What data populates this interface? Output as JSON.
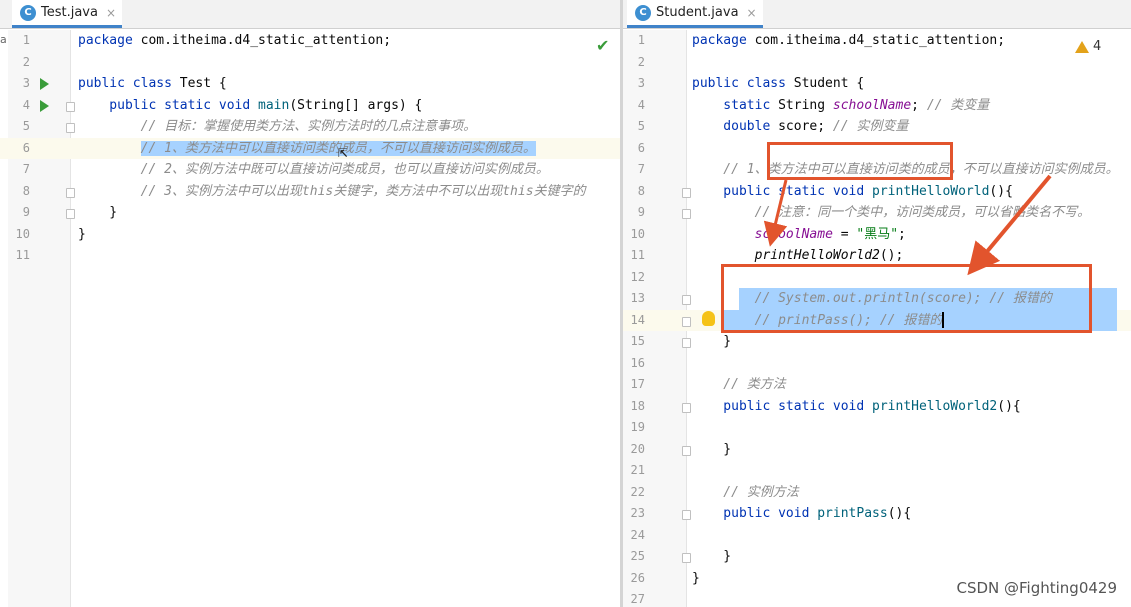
{
  "edge_char": "a",
  "left": {
    "tab": {
      "icon": "C",
      "label": "Test.java",
      "close": "×"
    },
    "lines": [
      {
        "n": "1",
        "parts": [
          {
            "t": "package ",
            "c": "kw"
          },
          {
            "t": "com.itheima.d4_static_attention;",
            "c": ""
          }
        ]
      },
      {
        "n": "2",
        "parts": []
      },
      {
        "n": "3",
        "parts": [
          {
            "t": "public class ",
            "c": "kw"
          },
          {
            "t": "Test {",
            "c": ""
          }
        ]
      },
      {
        "n": "4",
        "parts": [
          {
            "t": "    public static void ",
            "c": "kw"
          },
          {
            "t": "main",
            "c": "fn"
          },
          {
            "t": "(String[] args) {",
            "c": ""
          }
        ]
      },
      {
        "n": "5",
        "parts": [
          {
            "t": "        // 目标：掌握使用类方法、实例方法时的几点注意事项。",
            "c": "cm"
          }
        ]
      },
      {
        "n": "6",
        "parts": [
          {
            "t": "        ",
            "c": ""
          },
          {
            "t": "// 1、类方法中可以直接访问类的成员，不可以直接访问实例成员。",
            "c": "cm sel"
          }
        ]
      },
      {
        "n": "7",
        "parts": [
          {
            "t": "        // 2、实例方法中既可以直接访问类成员，也可以直接访问实例成员。",
            "c": "cm"
          }
        ]
      },
      {
        "n": "8",
        "parts": [
          {
            "t": "        // 3、实例方法中可以出现this关键字，类方法中不可以出现this关键字的",
            "c": "cm"
          }
        ]
      },
      {
        "n": "9",
        "parts": [
          {
            "t": "    }",
            "c": ""
          }
        ]
      },
      {
        "n": "10",
        "parts": [
          {
            "t": "}",
            "c": ""
          }
        ]
      },
      {
        "n": "11",
        "parts": []
      }
    ]
  },
  "right": {
    "tab": {
      "icon": "C",
      "label": "Student.java",
      "close": "×"
    },
    "warnings": "4",
    "lines": [
      {
        "n": "1",
        "parts": [
          {
            "t": "package ",
            "c": "kw"
          },
          {
            "t": "com.itheima.d4_static_attention;",
            "c": ""
          }
        ]
      },
      {
        "n": "2",
        "parts": []
      },
      {
        "n": "3",
        "parts": [
          {
            "t": "public class ",
            "c": "kw"
          },
          {
            "t": "Student {",
            "c": ""
          }
        ]
      },
      {
        "n": "4",
        "parts": [
          {
            "t": "    static ",
            "c": "kw"
          },
          {
            "t": "String ",
            "c": ""
          },
          {
            "t": "schoolName",
            "c": "fld"
          },
          {
            "t": "; ",
            "c": ""
          },
          {
            "t": "// 类变量",
            "c": "cm"
          }
        ]
      },
      {
        "n": "5",
        "parts": [
          {
            "t": "    double ",
            "c": "kw"
          },
          {
            "t": "score; ",
            "c": ""
          },
          {
            "t": "// 实例变量",
            "c": "cm"
          }
        ]
      },
      {
        "n": "6",
        "parts": []
      },
      {
        "n": "7",
        "parts": [
          {
            "t": "    // 1、类方法中可以直接访问类的成员，不可以直接访问实例成员。",
            "c": "cm"
          }
        ]
      },
      {
        "n": "8",
        "parts": [
          {
            "t": "    public static void ",
            "c": "kw"
          },
          {
            "t": "printHelloWorld",
            "c": "fn"
          },
          {
            "t": "(){",
            "c": ""
          }
        ]
      },
      {
        "n": "9",
        "parts": [
          {
            "t": "        // 注意：同一个类中，访问类成员，可以省略类名不写。",
            "c": "cm"
          }
        ]
      },
      {
        "n": "10",
        "parts": [
          {
            "t": "        ",
            "c": ""
          },
          {
            "t": "schoolName",
            "c": "fld"
          },
          {
            "t": " = ",
            "c": ""
          },
          {
            "t": "\"黑马\"",
            "c": "st"
          },
          {
            "t": ";",
            "c": ""
          }
        ]
      },
      {
        "n": "11",
        "parts": [
          {
            "t": "        ",
            "c": ""
          },
          {
            "t": "printHelloWorld2",
            "c": "stc"
          },
          {
            "t": "();",
            "c": ""
          }
        ]
      },
      {
        "n": "12",
        "parts": []
      },
      {
        "n": "13",
        "parts": [
          {
            "t": "        // System.out.println(score); // 报错的",
            "c": "cm"
          }
        ]
      },
      {
        "n": "14",
        "parts": [
          {
            "t": "        // printPass(); // 报错的",
            "c": "cm"
          }
        ]
      },
      {
        "n": "15",
        "parts": [
          {
            "t": "    }",
            "c": ""
          }
        ]
      },
      {
        "n": "16",
        "parts": []
      },
      {
        "n": "17",
        "parts": [
          {
            "t": "    // 类方法",
            "c": "cm"
          }
        ]
      },
      {
        "n": "18",
        "parts": [
          {
            "t": "    public static void ",
            "c": "kw"
          },
          {
            "t": "printHelloWorld2",
            "c": "fn"
          },
          {
            "t": "(){",
            "c": ""
          }
        ]
      },
      {
        "n": "19",
        "parts": []
      },
      {
        "n": "20",
        "parts": [
          {
            "t": "    }",
            "c": ""
          }
        ]
      },
      {
        "n": "21",
        "parts": []
      },
      {
        "n": "22",
        "parts": [
          {
            "t": "    // 实例方法",
            "c": "cm"
          }
        ]
      },
      {
        "n": "23",
        "parts": [
          {
            "t": "    public void ",
            "c": "kw"
          },
          {
            "t": "printPass",
            "c": "fn"
          },
          {
            "t": "(){",
            "c": ""
          }
        ]
      },
      {
        "n": "24",
        "parts": []
      },
      {
        "n": "25",
        "parts": [
          {
            "t": "    }",
            "c": ""
          }
        ]
      },
      {
        "n": "26",
        "parts": [
          {
            "t": "}",
            "c": ""
          }
        ]
      },
      {
        "n": "27",
        "parts": []
      }
    ]
  },
  "watermark": "CSDN @Fighting0429",
  "colors": {
    "accent": "#e2542d",
    "selection": "#a6d2ff",
    "keyword": "#0033b3",
    "comment": "#8c8c8c"
  }
}
